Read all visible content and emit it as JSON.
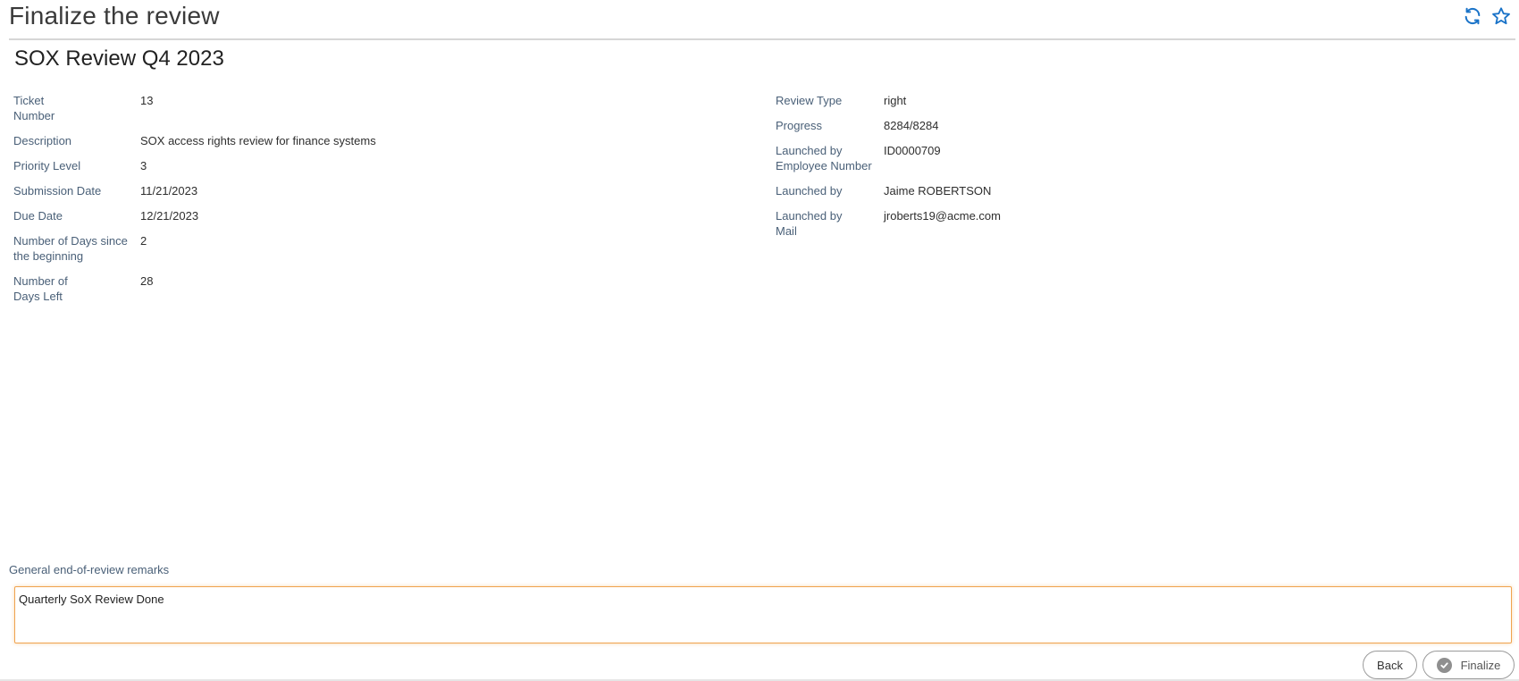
{
  "header": {
    "title": "Finalize the review",
    "refresh_icon": "refresh-icon",
    "favorite_icon": "star-icon"
  },
  "review": {
    "name": "SOX Review Q4 2023",
    "left_fields": [
      {
        "label_line1": "Ticket",
        "label_line2": "Number",
        "value": "13"
      },
      {
        "label_line1": "Description",
        "label_line2": "",
        "value": "SOX access rights review for finance systems"
      },
      {
        "label_line1": "Priority Level",
        "label_line2": "",
        "value": "3"
      },
      {
        "label_line1": "Submission Date",
        "label_line2": "",
        "value": "11/21/2023"
      },
      {
        "label_line1": "Due Date",
        "label_line2": "",
        "value": "12/21/2023"
      },
      {
        "label_line1": "Number of Days since",
        "label_line2": "the beginning",
        "value": "2"
      },
      {
        "label_line1": "Number of",
        "label_line2": "Days Left",
        "value": "28"
      }
    ],
    "right_fields": [
      {
        "label_line1": "Review Type",
        "label_line2": "",
        "value": "right"
      },
      {
        "label_line1": "Progress",
        "label_line2": "",
        "value": "8284/8284"
      },
      {
        "label_line1": "Launched by",
        "label_line2": "Employee Number",
        "value": "ID0000709"
      },
      {
        "label_line1": "Launched by",
        "label_line2": "",
        "value": "Jaime ROBERTSON"
      },
      {
        "label_line1": "Launched by",
        "label_line2": "Mail",
        "value": "jroberts19@acme.com"
      }
    ]
  },
  "remarks": {
    "label": "General end-of-review remarks",
    "value": "Quarterly SoX Review Done"
  },
  "actions": {
    "back_label": "Back",
    "finalize_label": "Finalize"
  },
  "colors": {
    "accent": "#1a73c8",
    "label": "#4a6078",
    "focus_border": "#f0a34e"
  }
}
